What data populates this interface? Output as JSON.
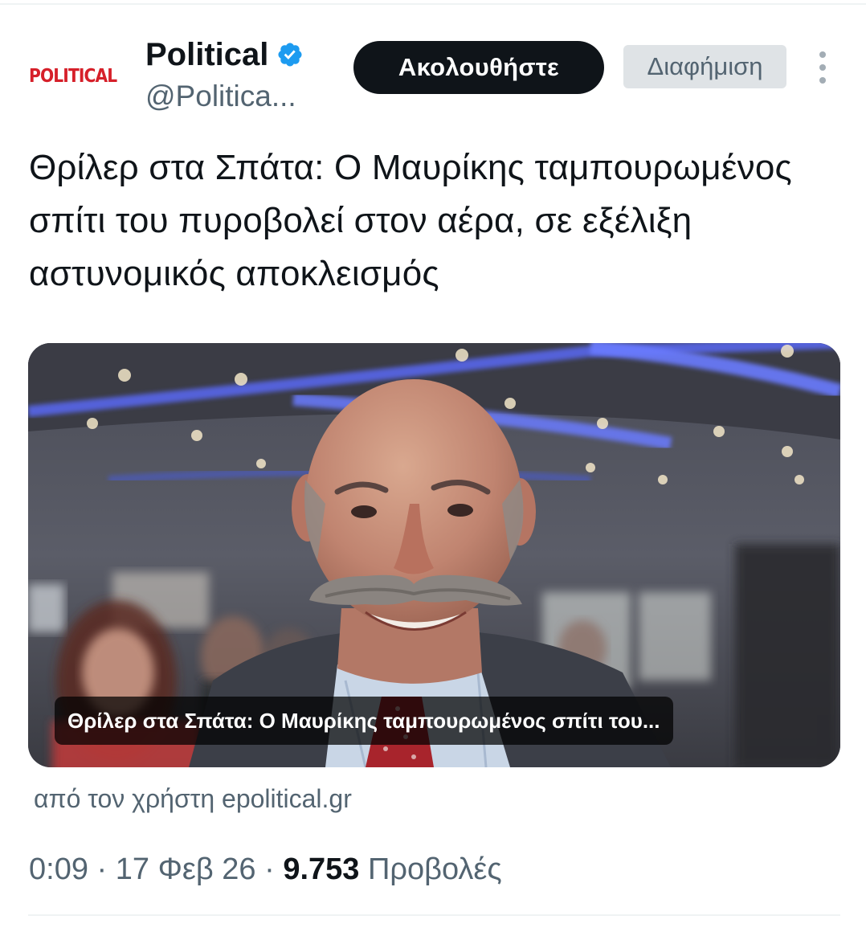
{
  "account": {
    "logo_text": "POLITICAL",
    "display_name": "Political",
    "handle": "@Politica...",
    "verified_icon": "verified-badge-icon",
    "verified_color": "#1d9bf0"
  },
  "actions": {
    "follow_label": "Ακολουθήστε",
    "ad_label": "Διαφήμιση",
    "more_icon": "more-options-icon"
  },
  "tweet": {
    "text": "Θρίλερ στα Σπάτα: Ο Μαυρίκης ταμπουρωμένος σπίτι του πυροβολεί στον αέρα, σε εξέλιξη αστυνομικός αποκλεισμός"
  },
  "card": {
    "title": "Θρίλερ στα Σπάτα: Ο Μαυρίκης ταμπουρωμένος σπίτι του...",
    "source": "από τον χρήστη epolitical.gr",
    "image": "photo of a smiling bald man with a grey mustache at an indoor event"
  },
  "meta": {
    "time": "0:09",
    "separator": "·",
    "date": "17 Φεβ 26",
    "views_count": "9.753",
    "views_label": "Προβολές"
  },
  "colors": {
    "text_primary": "#0f1419",
    "text_secondary": "#536471",
    "logo_red": "#d6202a",
    "follow_bg": "#0f1419",
    "ad_bg": "#dfe3e6"
  }
}
